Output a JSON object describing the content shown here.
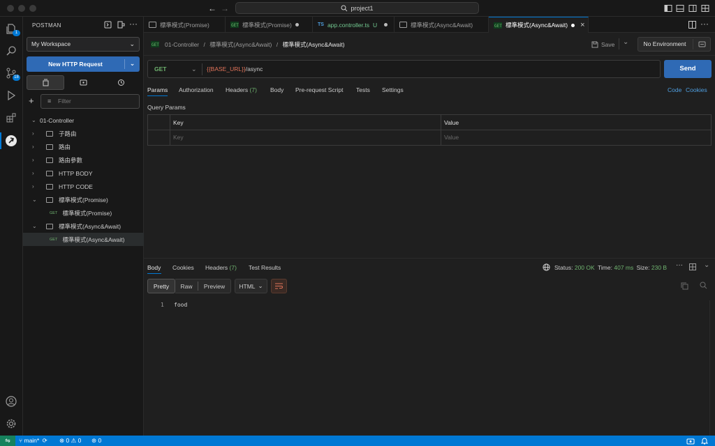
{
  "window": {
    "search_text": "project1"
  },
  "activity": {
    "explorer_badge": "1",
    "scm_badge": "18"
  },
  "sidebar": {
    "title": "POSTMAN",
    "workspace": "My Workspace",
    "new_request": "New HTTP Request",
    "filter_placeholder": "Filter",
    "collection": "01-Controller",
    "folders": [
      "子路由",
      "路由",
      "路由參數",
      "HTTP BODY",
      "HTTP CODE",
      "標準模式(Promise)",
      "標準模式(Async&Await)"
    ],
    "requests": [
      {
        "method": "GET",
        "name": "標準模式(Promise)"
      },
      {
        "method": "GET",
        "name": "標準模式(Async&Await)"
      }
    ]
  },
  "tabs": [
    {
      "label": "標準模式(Promise)",
      "kind": "folder"
    },
    {
      "label": "標準模式(Promise)",
      "kind": "request",
      "modified": true
    },
    {
      "label": "app.controller.ts",
      "kind": "ts",
      "suffix": "U",
      "modified": true
    },
    {
      "label": "標準模式(Async&Await)",
      "kind": "folder"
    },
    {
      "label": "標準模式(Async&Await)",
      "kind": "request",
      "modified": true,
      "active": true
    }
  ],
  "breadcrumb": {
    "part1": "01-Controller",
    "part2": "標準模式(Async&Await)",
    "current": "標準模式(Async&Await)",
    "sep": "/"
  },
  "toolbar": {
    "save": "Save",
    "environment": "No Environment"
  },
  "request": {
    "method": "GET",
    "url_var": "{{BASE_URL}}",
    "url_path": "/async",
    "send": "Send"
  },
  "request_tabs": {
    "params": "Params",
    "authorization": "Authorization",
    "headers": "Headers",
    "headers_count": "(7)",
    "body": "Body",
    "prerequest": "Pre-request Script",
    "tests": "Tests",
    "settings": "Settings",
    "code": "Code",
    "cookies": "Cookies"
  },
  "query": {
    "title": "Query Params",
    "col_key": "Key",
    "col_value": "Value",
    "key_placeholder": "Key",
    "value_placeholder": "Value"
  },
  "response": {
    "tabs": {
      "body": "Body",
      "cookies": "Cookies",
      "headers": "Headers",
      "headers_count": "(7)",
      "test_results": "Test Results"
    },
    "status_label": "Status:",
    "status_value": "200 OK",
    "time_label": "Time:",
    "time_value": "407 ms",
    "size_label": "Size:",
    "size_value": "230 B",
    "views": {
      "pretty": "Pretty",
      "raw": "Raw",
      "preview": "Preview"
    },
    "format": "HTML",
    "line_no": "1",
    "body_text": "food"
  },
  "statusbar": {
    "branch": "main*",
    "errors": "0",
    "warnings": "0",
    "ports": "0"
  },
  "colors": {
    "accent": "#0078d4",
    "send": "#2f6ab5",
    "url_var": "#e2745a",
    "method_get": "#6fb36f",
    "status_ok": "#6fb36f"
  }
}
